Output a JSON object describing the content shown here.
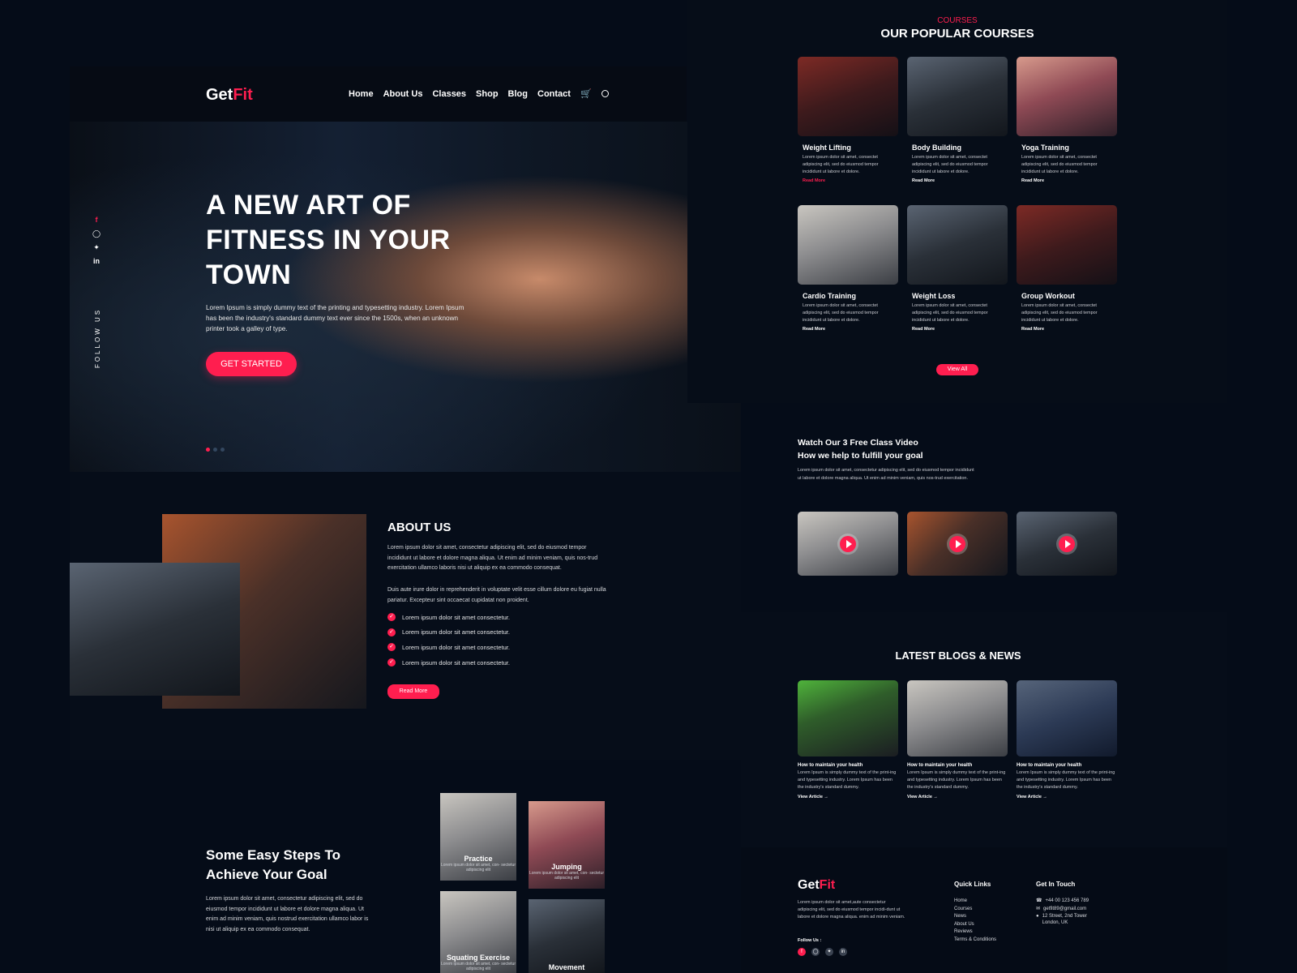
{
  "brand": {
    "logo_main": "Get",
    "logo_accent": "Fit",
    "accent_color": "#ff1e4f"
  },
  "nav": {
    "items": [
      "Home",
      "About Us",
      "Classes",
      "Shop",
      "Blog",
      "Contact"
    ],
    "icons": [
      "cart-icon",
      "search-icon"
    ]
  },
  "hero": {
    "title_lines": [
      "A NEW ART OF",
      "FITNESS IN YOUR",
      "TOWN"
    ],
    "text": "Lorem Ipsum is simply dummy text of the printing and typesetting industry. Lorem Ipsum has been the industry's standard dummy text ever since the 1500s, when an unknown printer took a galley of type.",
    "cta": "GET STARTED",
    "follow": "FOLLOW US",
    "social_icons": [
      "facebook-icon",
      "instagram-icon",
      "twitter-icon",
      "linkedin-icon"
    ],
    "slide_active": 1,
    "slide_count": 3
  },
  "about": {
    "title": "ABOUT US",
    "para1": "Lorem ipsum dolor sit amet, consectetur adipiscing elit, sed do eiusmod tempor incididunt ut labore et dolore magna aliqua. Ut enim ad minim veniam, quis nos-trud exercitation ullamco laboris nisi ut aliquip ex ea commodo consequat.",
    "para2": "Duis aute irure dolor in reprehenderit in  voluptate velit esse cillum dolore eu fugiat nulla pariatur. Excepteur sint occaecat cupidatat non proident.",
    "checks": [
      "Lorem ipsum dolor sit amet consectetur.",
      "Lorem ipsum dolor sit amet consectetur.",
      "Lorem ipsum dolor sit amet consectetur.",
      "Lorem ipsum dolor sit amet consectetur."
    ],
    "button": "Read More"
  },
  "steps": {
    "title_lines": [
      "Some Easy Steps To",
      "Achieve Your Goal"
    ],
    "text": "Lorem ipsum dolor sit amet, consectetur adipiscing elit, sed do eiusmod tempor incididunt ut labore et dolore magna aliqua. Ut enim ad minim veniam, quis nostrud exercitation ullamco labor is nisi ut aliquip ex ea commodo consequat.",
    "tiles": [
      {
        "name": "Practice",
        "sub": "Lorem ipsum dolor sit amet, con- sectetur adipiscing elit"
      },
      {
        "name": "Jumping",
        "sub": "Lorem ipsum dolor sit amet, con- sectetur adipiscing elit"
      },
      {
        "name": "Squating Exercise",
        "sub": "Lorem ipsum dolor sit amet, con- sectetur adipiscing elit"
      },
      {
        "name": "Movement",
        "sub": ""
      }
    ]
  },
  "courses": {
    "eyebrow": "COURSES",
    "title": "OUR POPULAR COURSES",
    "items": [
      {
        "title": "Weight Lifting",
        "desc": "Lorem ipsum dolor sit amet, consectet adipiscing elit, sed do eiusmod tempor incididunt ut labore et dolore.",
        "more": "Read More"
      },
      {
        "title": "Body Building",
        "desc": "Lorem ipsum dolor sit amet, consectet adipiscing elit, sed do eiusmod tempor incididunt ut labore et dolore.",
        "more": "Read More"
      },
      {
        "title": "Yoga Training",
        "desc": "Lorem ipsum dolor sit amet, consectet adipiscing elit, sed do eiusmod tempor incididunt ut labore et dolore.",
        "more": "Read More"
      },
      {
        "title": "Cardio Training",
        "desc": "Lorem ipsum dolor sit amet, consectet adipiscing elit, sed do eiusmod tempor incididunt ut labore et dolore.",
        "more": "Read More"
      },
      {
        "title": "Weight Loss",
        "desc": "Lorem ipsum dolor sit amet, consectet adipiscing elit, sed do eiusmod tempor incididunt ut labore et dolore.",
        "more": "Read More"
      },
      {
        "title": "Group Workout",
        "desc": "Lorem ipsum dolor sit amet, consectet adipiscing elit, sed do eiusmod tempor incididunt ut labore et dolore.",
        "more": "Read More"
      }
    ],
    "view_all": "View All"
  },
  "video": {
    "title_lines": [
      "Watch Our 3 Free Class Video",
      "How we help to fulfill your goal"
    ],
    "text": "Lorem ipsum dolor sit amet, consectetur adipiscing elit, sed do eiusmod tempor incididunt ut labore et dolore magna aliqua. Ut enim ad minim veniam, quis nos-trud exercitation."
  },
  "blog": {
    "title": "LATEST BLOGS & NEWS",
    "items": [
      {
        "title": "How to maintain your health",
        "desc": "Lorem Ipsum is simply dummy text of the print-ing and typesetting industry. Lorem Ipsum has been the industry's standard dummy.",
        "link": "View Article →"
      },
      {
        "title": "How to maintain your health",
        "desc": "Lorem Ipsum is simply dummy text of the print-ing and typesetting industry. Lorem Ipsum has been the industry's standard dummy.",
        "link": "View Article →"
      },
      {
        "title": "How to maintain your health",
        "desc": "Lorem Ipsum is simply dummy text of the print-ing and typesetting industry. Lorem Ipsum has been the industry's standard dummy.",
        "link": "View Article →"
      }
    ]
  },
  "footer": {
    "about": "Lorem ipsum dolor sit amet,aute consectetur adipiscing elit, sed do eiusmod tempor incidi-dunt ut labore et dolore magna aliqua. enim ad minim veniam.",
    "follow_label": "Follow Us :",
    "quick_links_title": "Quick Links",
    "quick_links": [
      "Home",
      "Courses",
      "News",
      "About Us",
      "Reviews",
      "Terms & Conditions"
    ],
    "contact_title": "Get In Touch",
    "phone": "+44 00 123 456 789",
    "email": "getfit89@gmail.com",
    "address_lines": [
      "12 Street, 2nd Tower",
      "London, UK"
    ]
  }
}
